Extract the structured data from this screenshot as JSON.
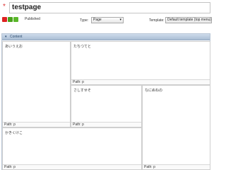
{
  "header": {
    "required_mark": "*",
    "title_value": "testpage"
  },
  "status": {
    "label": "Published",
    "buttons": [
      "red",
      "green",
      "green"
    ]
  },
  "type_field": {
    "label": "Type:",
    "value": "Page"
  },
  "template_field": {
    "label": "Template:",
    "value": "Default template (top menu)"
  },
  "content_panel": {
    "toggle": "▾",
    "title": "Content",
    "regions": [
      {
        "text": "あいうえお",
        "path": "Path: p"
      },
      {
        "text": "たちつてと",
        "path": "Path: p"
      },
      {
        "text": "さしすせそ",
        "path": "Path: p"
      },
      {
        "text": "なにぬねの",
        "path": "Path: p"
      },
      {
        "text": "かきくけこ",
        "path": "Path: p"
      }
    ]
  },
  "colors": {
    "header_gradient_top": "#cfdceb",
    "header_gradient_bottom": "#a9bdd4",
    "status_red": "#dd2222",
    "status_green": "#4aa31c"
  }
}
